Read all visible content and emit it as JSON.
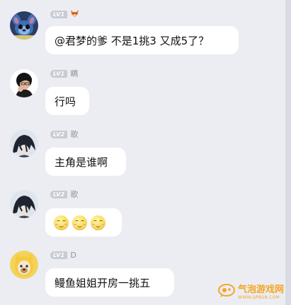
{
  "messages": [
    {
      "level": "LV1",
      "nickname": "",
      "text": "@君梦的爹 不是1挑3 又成5了？"
    },
    {
      "level": "LV1",
      "nickname": "瞒",
      "text": "行吗"
    },
    {
      "level": "LV2",
      "nickname": "歌",
      "text": "主角是谁啊"
    },
    {
      "level": "LV2",
      "nickname": "歌",
      "emojis": [
        "smile",
        "smile",
        "smile"
      ]
    },
    {
      "level": "LV1",
      "nickname": "D",
      "text": "鳗鱼姐姐开房一挑五"
    }
  ],
  "watermark": {
    "main": "气泡游戏网",
    "sub": "WWW.QPB28.COM"
  },
  "colors": {
    "background": "#ebedf3",
    "bubble": "#ffffff",
    "level_badge": "#c7cbd6",
    "nickname": "#8f939c",
    "watermark": "#f6a623"
  }
}
